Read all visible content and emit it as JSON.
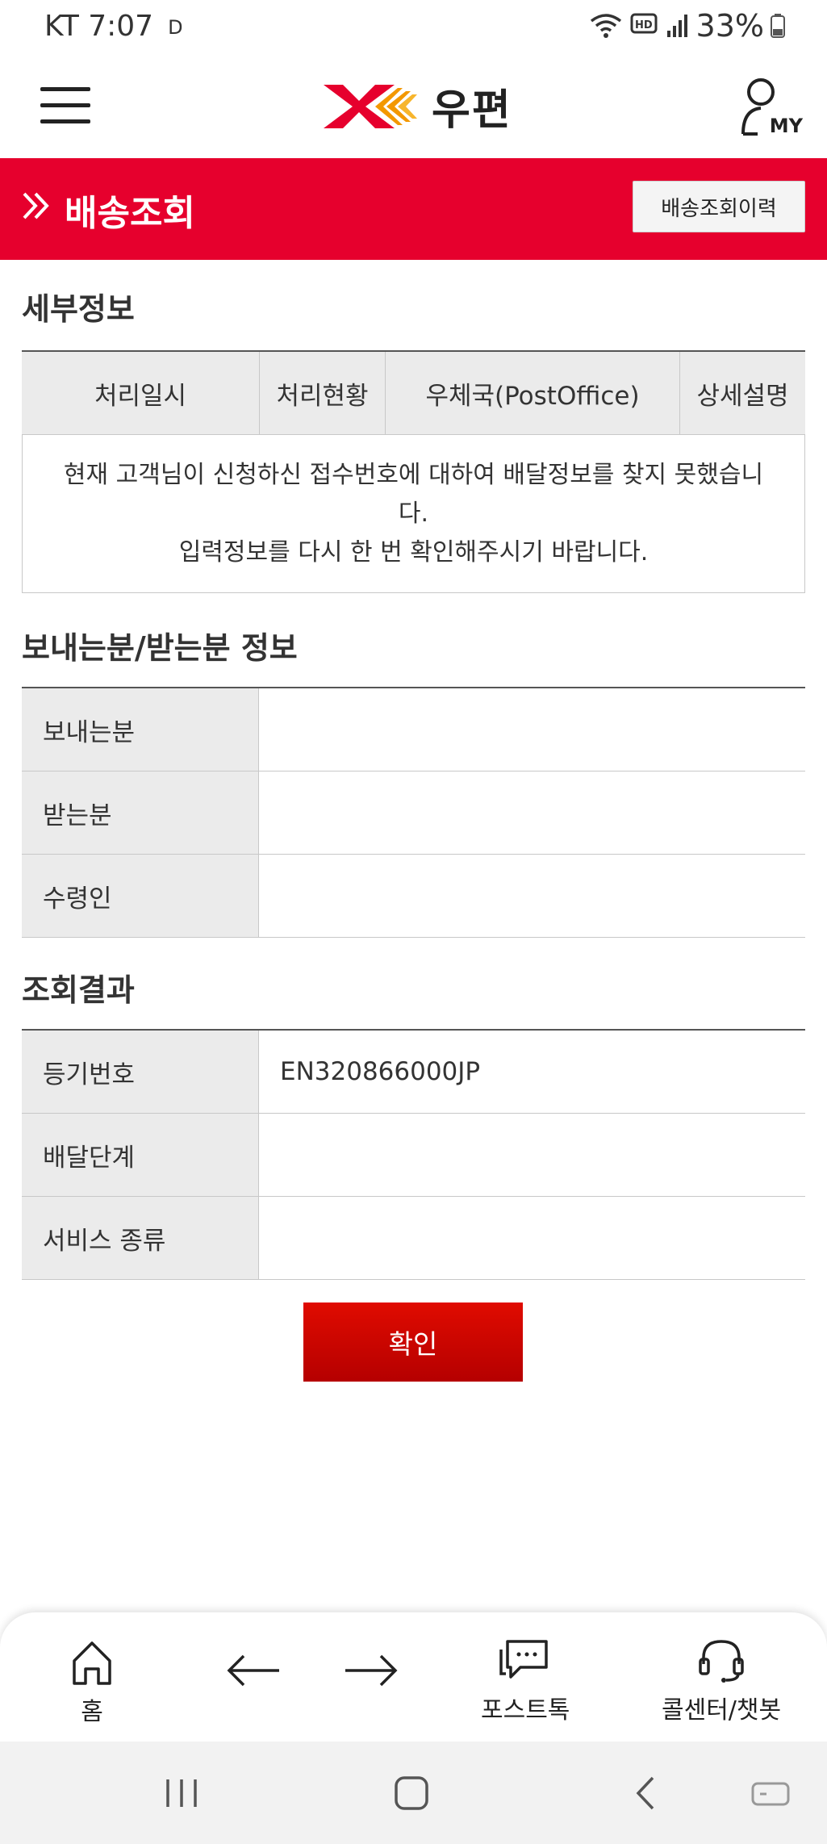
{
  "status_bar": {
    "carrier_time": "KT 7:07",
    "indicator": "D",
    "battery": "33%"
  },
  "header": {
    "logo_text": "우편",
    "my_label": "MY"
  },
  "title_bar": {
    "title": "배송조회",
    "history_button": "배송조회이력",
    "accent_color": "#e6002d"
  },
  "detail": {
    "section_title": "세부정보",
    "columns": [
      "처리일시",
      "처리현황",
      "우체국(PostOffice)",
      "상세설명"
    ],
    "message_line1": "현재 고객님이 신청하신 접수번호에 대하여 배달정보를 찾지 못했습니",
    "message_line2": "다.",
    "message_line3": "입력정보를 다시 한 번 확인해주시기 바랍니다."
  },
  "sender_receiver": {
    "section_title": "보내는분/받는분 정보",
    "rows": [
      {
        "label": "보내는분",
        "value": ""
      },
      {
        "label": "받는분",
        "value": ""
      },
      {
        "label": "수령인",
        "value": ""
      }
    ]
  },
  "result": {
    "section_title": "조회결과",
    "rows": [
      {
        "label": "등기번호",
        "value": "EN320866000JP"
      },
      {
        "label": "배달단계",
        "value": ""
      },
      {
        "label": "서비스 종류",
        "value": ""
      }
    ]
  },
  "confirm_button": "확인",
  "bottom_nav": {
    "home": "홈",
    "back_icon": "arrow-left-icon",
    "forward_icon": "arrow-right-icon",
    "posttalk": "포스트톡",
    "callcenter": "콜센터/챗봇"
  }
}
